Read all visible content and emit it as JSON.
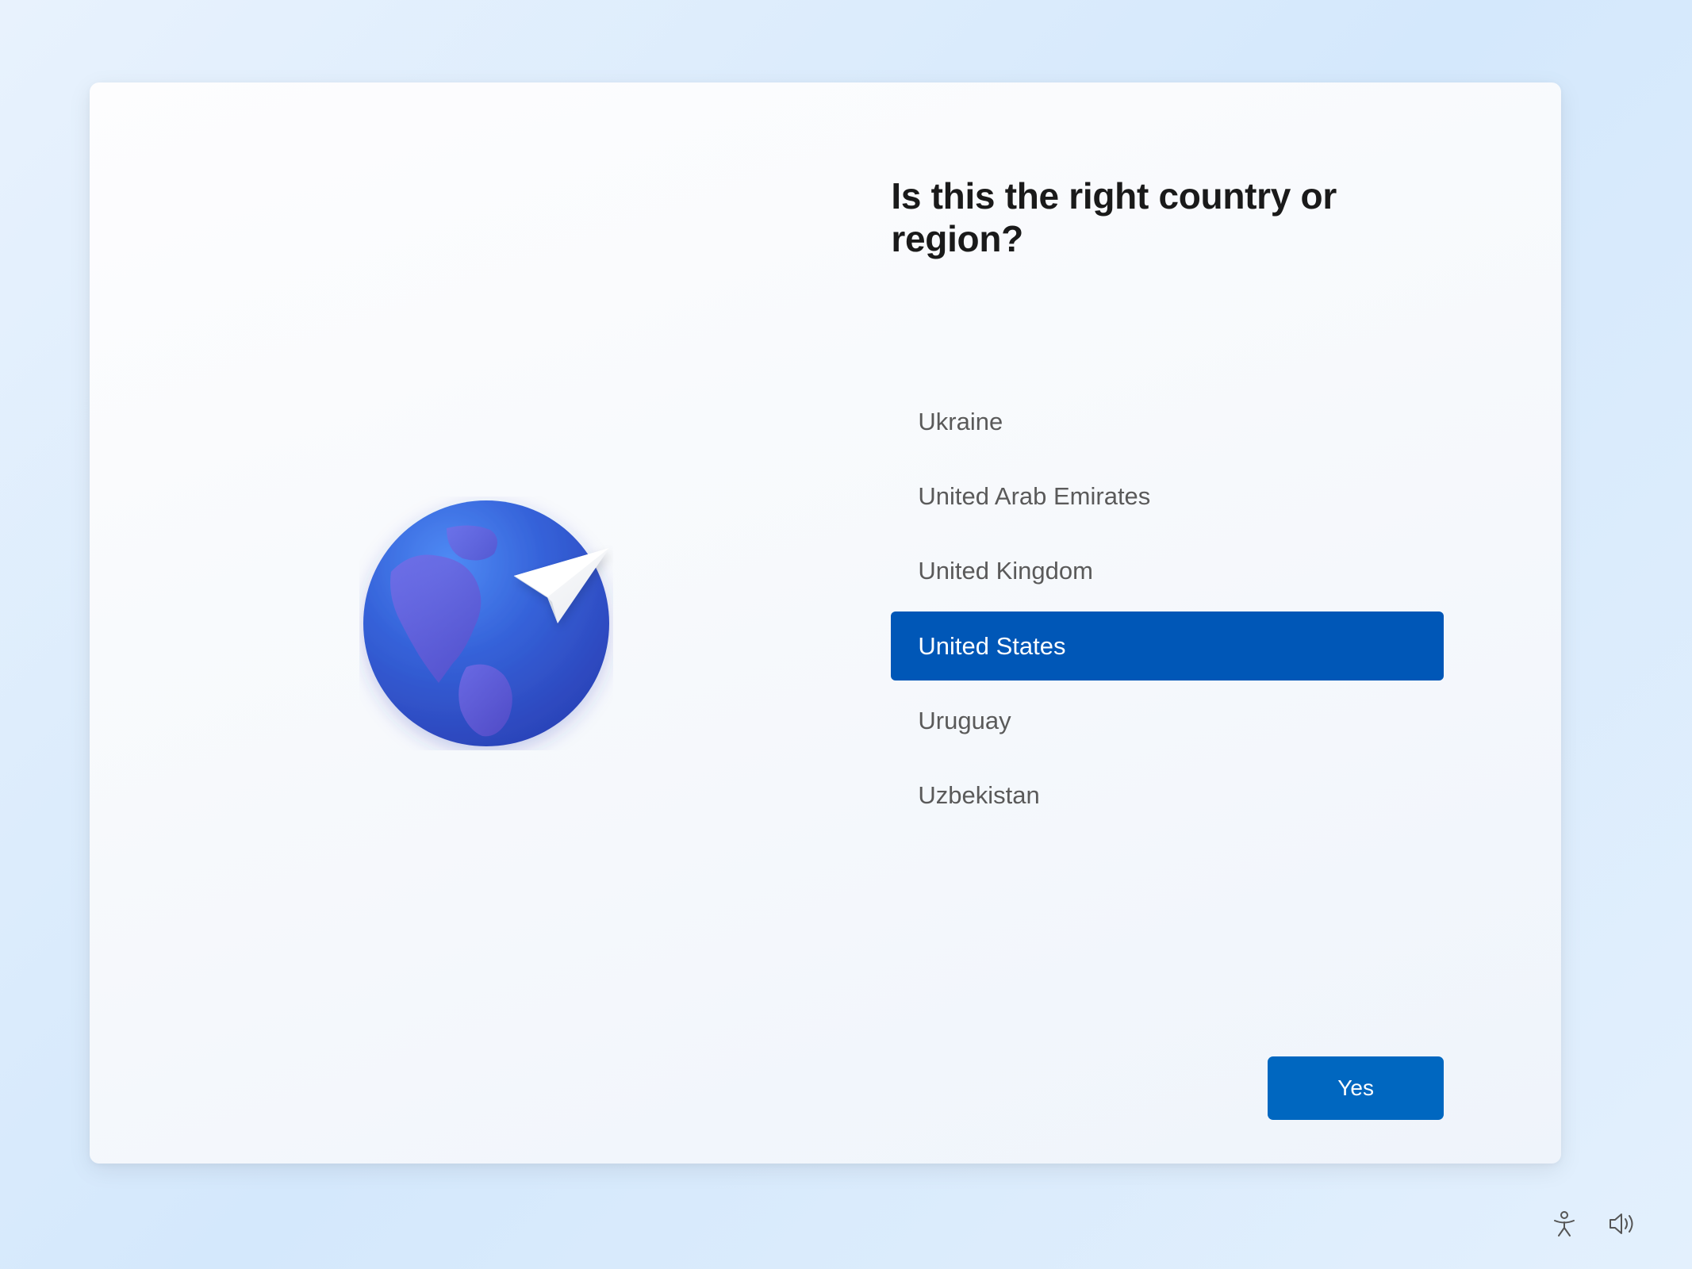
{
  "heading": "Is this the right country or region?",
  "countries": [
    {
      "name": "Ukraine",
      "selected": false
    },
    {
      "name": "United Arab Emirates",
      "selected": false
    },
    {
      "name": "United Kingdom",
      "selected": false
    },
    {
      "name": "United States",
      "selected": true
    },
    {
      "name": "Uruguay",
      "selected": false
    },
    {
      "name": "Uzbekistan",
      "selected": false
    }
  ],
  "primary_button_label": "Yes",
  "icons": {
    "accessibility": "accessibility-icon",
    "volume": "volume-icon"
  },
  "colors": {
    "accent": "#0067c0",
    "selected": "#0057b7"
  }
}
